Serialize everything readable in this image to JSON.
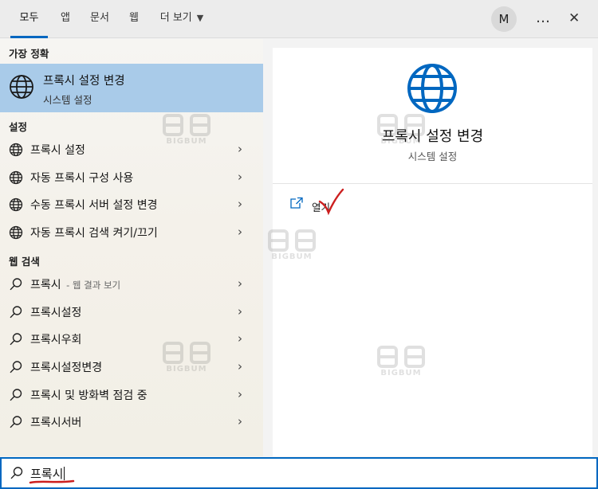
{
  "tabs": [
    {
      "label": "모두",
      "active": true
    },
    {
      "label": "앱"
    },
    {
      "label": "문서"
    },
    {
      "label": "웹"
    },
    {
      "label": "더 보기"
    }
  ],
  "avatar_letter": "M",
  "icons": {
    "more": "…",
    "close": "✕",
    "arrow": "›"
  },
  "best_match": {
    "section": "가장 정확",
    "title": "프록시 설정 변경",
    "subtitle": "시스템 설정"
  },
  "settings": {
    "section": "설정",
    "items": [
      "프록시 설정",
      "자동 프록시 구성 사용",
      "수동 프록시 서버 설정 변경",
      "자동 프록시 검색 켜기/끄기"
    ]
  },
  "web": {
    "section": "웹 검색",
    "first_item": {
      "label": "프록시",
      "suffix": "- 웹 결과 보기"
    },
    "items": [
      "프록시설정",
      "프록시우회",
      "프록시설정변경",
      "프록시 및 방화벽 점검 중",
      "프록시서버"
    ]
  },
  "detail": {
    "title": "프록시 설정 변경",
    "subtitle": "시스템 설정",
    "open_label": "열기"
  },
  "watermark": "BIGBUM",
  "search": {
    "query": "프록시"
  },
  "colors": {
    "accent": "#0067c0",
    "selected": "#a9cbe9",
    "annotation": "#cc1f1f"
  }
}
